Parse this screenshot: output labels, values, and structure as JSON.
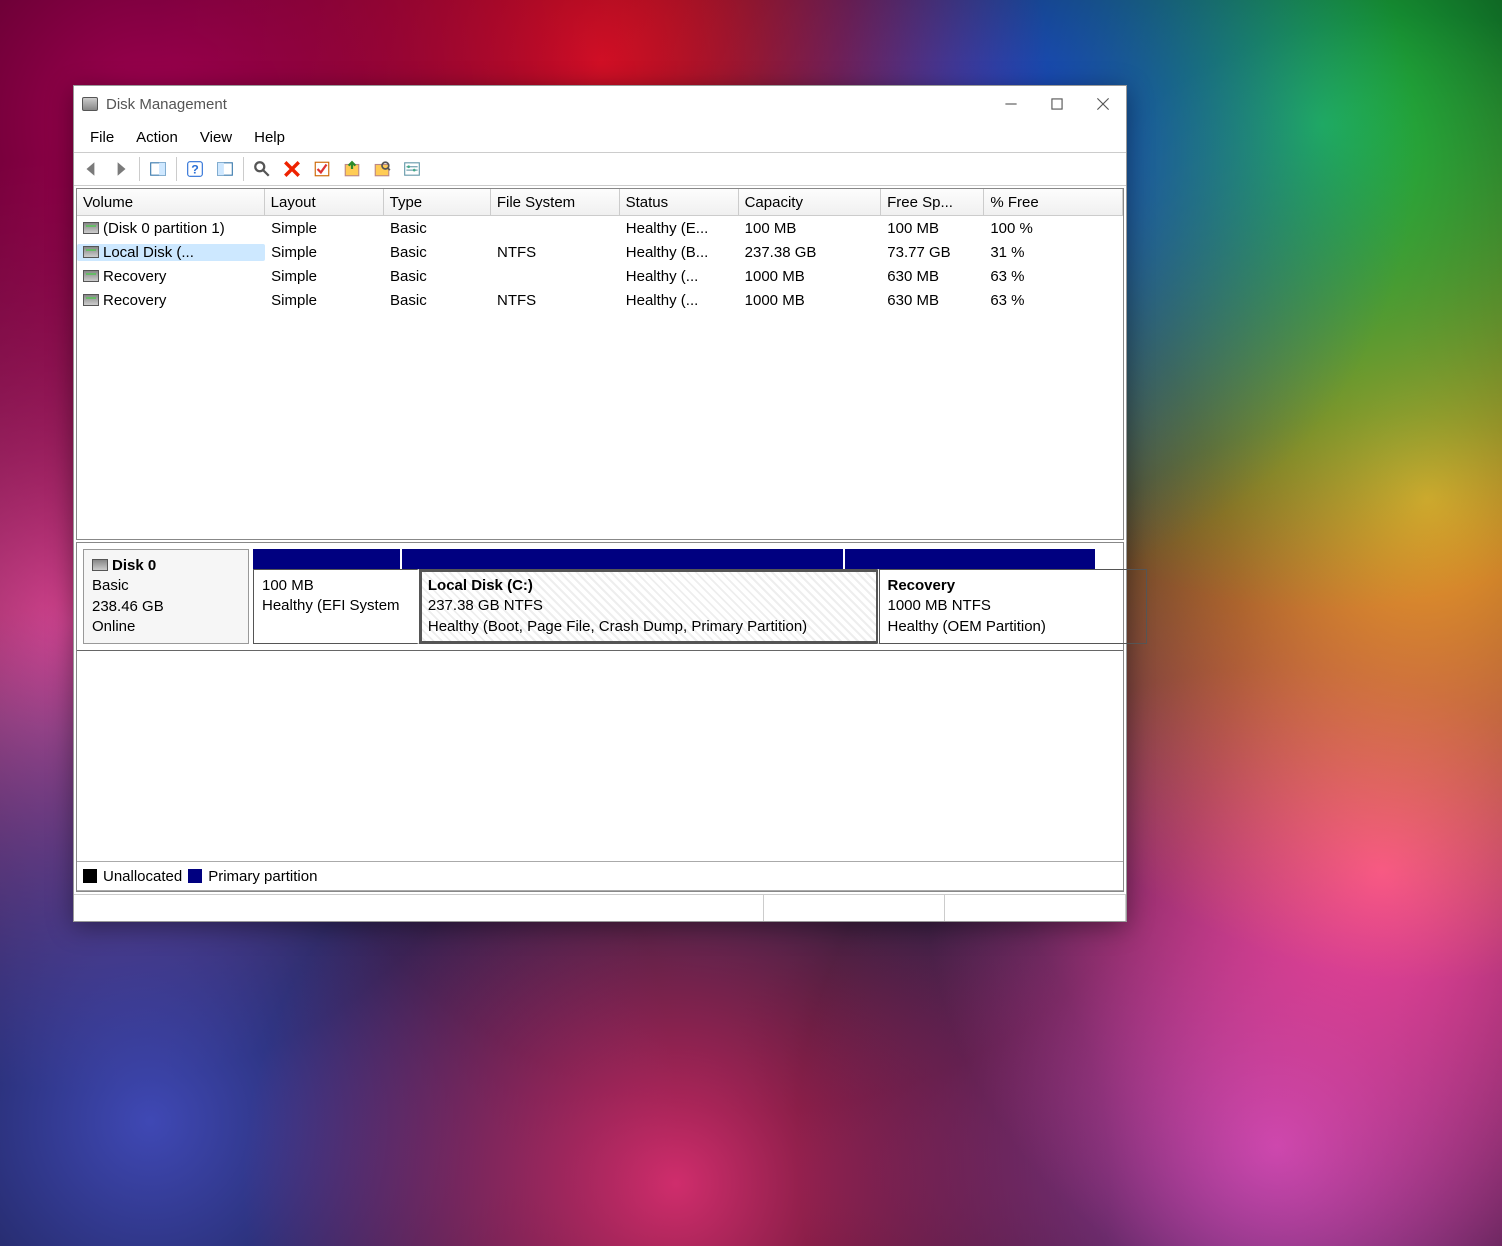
{
  "window": {
    "title": "Disk Management"
  },
  "menus": {
    "file": "File",
    "action": "Action",
    "view": "View",
    "help": "Help"
  },
  "columns": {
    "volume": "Volume",
    "layout": "Layout",
    "type": "Type",
    "filesystem": "File System",
    "status": "Status",
    "capacity": "Capacity",
    "freespace": "Free Sp...",
    "pctfree": "% Free"
  },
  "volumes": [
    {
      "name": "(Disk 0 partition 1)",
      "layout": "Simple",
      "type": "Basic",
      "fs": "",
      "status": "Healthy (E...",
      "capacity": "100 MB",
      "free": "100 MB",
      "pct": "100 %",
      "selected": false
    },
    {
      "name": "Local Disk (...",
      "layout": "Simple",
      "type": "Basic",
      "fs": "NTFS",
      "status": "Healthy (B...",
      "capacity": "237.38 GB",
      "free": "73.77 GB",
      "pct": "31 %",
      "selected": true
    },
    {
      "name": "Recovery",
      "layout": "Simple",
      "type": "Basic",
      "fs": "",
      "status": "Healthy (...",
      "capacity": "1000 MB",
      "free": "630 MB",
      "pct": "63 %",
      "selected": false
    },
    {
      "name": "Recovery",
      "layout": "Simple",
      "type": "Basic",
      "fs": "NTFS",
      "status": "Healthy (...",
      "capacity": "1000 MB",
      "free": "630 MB",
      "pct": "63 %",
      "selected": false
    }
  ],
  "disk": {
    "name": "Disk 0",
    "kind": "Basic",
    "size": "238.46 GB",
    "state": "Online",
    "parts": [
      {
        "title": "",
        "line1": "100 MB",
        "line2": "Healthy (EFI System",
        "width": 17,
        "selected": false
      },
      {
        "title": "Local Disk  (C:)",
        "line1": "237.38 GB NTFS",
        "line2": "Healthy (Boot, Page File, Crash Dump, Primary Partition)",
        "width": 51,
        "selected": true
      },
      {
        "title": "Recovery",
        "line1": "1000 MB NTFS",
        "line2": "Healthy (OEM Partition)",
        "width": 29,
        "selected": false
      }
    ]
  },
  "legend": {
    "unallocated": "Unallocated",
    "primary": "Primary partition"
  }
}
